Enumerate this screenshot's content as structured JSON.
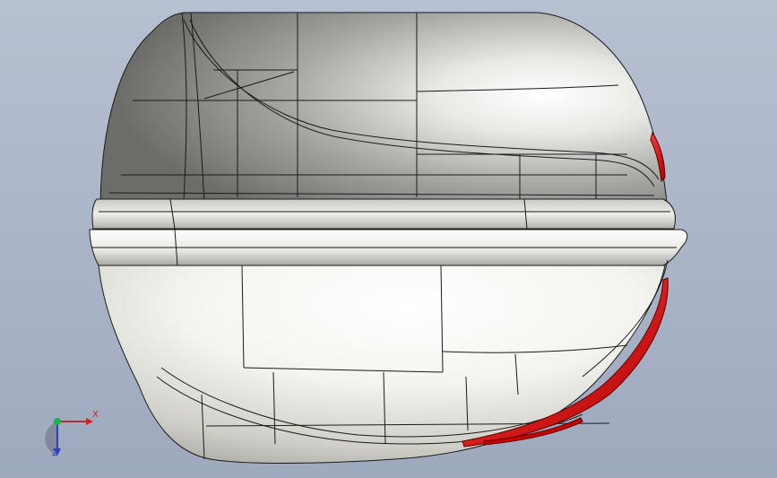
{
  "viewport": {
    "background_top": "#b7c0d1",
    "background_bottom": "#9ea9be"
  },
  "model": {
    "body_color": "#d8d8d2",
    "accent_color": "#e01010",
    "edge_color": "#1a1a1a"
  },
  "triad": {
    "x_label": "X",
    "z_label": "Z",
    "x_color": "#d42020",
    "y_color": "#22b04a",
    "z_color": "#2b3fbf"
  }
}
